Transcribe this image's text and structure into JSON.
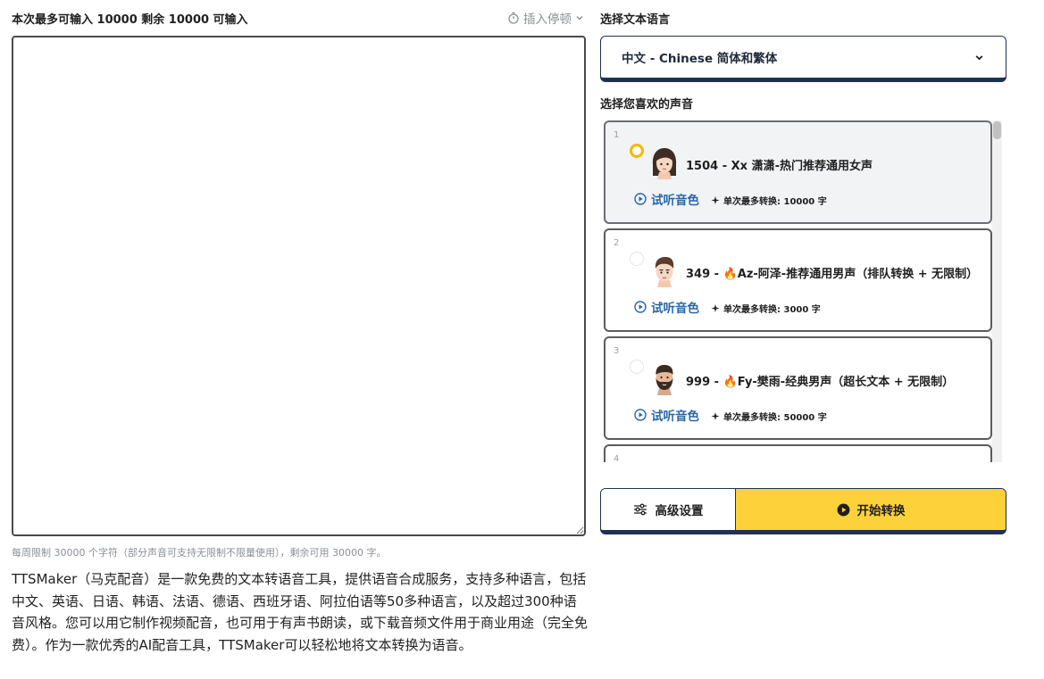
{
  "editor": {
    "limit_text": "本次最多可输入 10000 剩余 10000 可输入",
    "insert_pause_label": "插入停顿",
    "text_value": "",
    "weekly_note": "每周限制 30000 个字符（部分声音可支持无限制不限量使用），剩余可用 30000 字。",
    "description": "TTSMaker（马克配音）是一款免费的文本转语音工具，提供语音合成服务，支持多种语言，包括中文、英语、日语、韩语、法语、德语、西班牙语、阿拉伯语等50多种语言，以及超过300种语音风格。您可以用它制作视频配音，也可用于有声书朗读，或下载音频文件用于商业用途（完全免费）。作为一款优秀的AI配音工具，TTSMaker可以轻松地将文本转换为语音。"
  },
  "language": {
    "label": "选择文本语言",
    "selected": "中文 - Chinese 简体和繁体"
  },
  "voices": {
    "label": "选择您喜欢的声音",
    "items": [
      {
        "index": "1",
        "name": "1504 - Xx 潇潇-热门推荐通用女声",
        "listen_label": "试听音色",
        "max_conversion": "单次最多转换: 10000 字",
        "selected": true,
        "avatar_icon": "female-avatar-icon"
      },
      {
        "index": "2",
        "name": "349 - 🔥Az-阿泽-推荐通用男声（排队转换 + 无限制）",
        "listen_label": "试听音色",
        "max_conversion": "单次最多转换: 3000 字",
        "selected": false,
        "avatar_icon": "male-avatar-icon"
      },
      {
        "index": "3",
        "name": "999 - 🔥Fy-樊雨-经典男声（超长文本 + 无限制）",
        "listen_label": "试听音色",
        "max_conversion": "单次最多转换: 50000 字",
        "selected": false,
        "avatar_icon": "bearded-male-avatar-icon"
      },
      {
        "index": "4",
        "name": "",
        "listen_label": "",
        "max_conversion": "",
        "selected": false,
        "avatar_icon": ""
      }
    ]
  },
  "actions": {
    "advanced_label": "高级设置",
    "start_label": "开始转换"
  },
  "colors": {
    "accent_yellow": "#fdd13a",
    "dark_navy": "#1e3252",
    "link_blue": "#2966a8"
  }
}
